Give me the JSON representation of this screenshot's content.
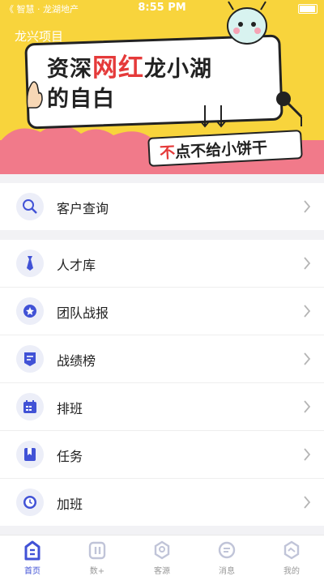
{
  "status_bar": {
    "carrier": "《 智慧 · 龙湖地产",
    "time": "8:55 PM"
  },
  "banner": {
    "project_title": "龙兴项目",
    "headline_prefix": "资深",
    "headline_red": "网红",
    "headline_suffix": "龙小湖",
    "headline_line2": "的自白",
    "tag_red": "不",
    "tag_rest": "点不给小饼干"
  },
  "menu_top": [
    {
      "label": "客户查询",
      "icon": "search-icon"
    }
  ],
  "menu_main": [
    {
      "label": "人才库",
      "icon": "tie-icon"
    },
    {
      "label": "团队战报",
      "icon": "star-badge-icon"
    },
    {
      "label": "战绩榜",
      "icon": "document-icon"
    },
    {
      "label": "排班",
      "icon": "calendar-icon"
    },
    {
      "label": "任务",
      "icon": "bookmark-icon"
    },
    {
      "label": "加班",
      "icon": "clock-icon"
    }
  ],
  "tabs": [
    {
      "label": "首页",
      "icon": "home-icon",
      "active": true
    },
    {
      "label": "数+",
      "icon": "data-icon",
      "active": false
    },
    {
      "label": "客源",
      "icon": "customer-icon",
      "active": false
    },
    {
      "label": "消息",
      "icon": "message-icon",
      "active": false
    },
    {
      "label": "我的",
      "icon": "profile-icon",
      "active": false
    }
  ],
  "colors": {
    "accent": "#4152d6",
    "banner_yellow": "#f8d43c",
    "banner_pink": "#f17a8a",
    "icon_bg": "#eceef8"
  }
}
